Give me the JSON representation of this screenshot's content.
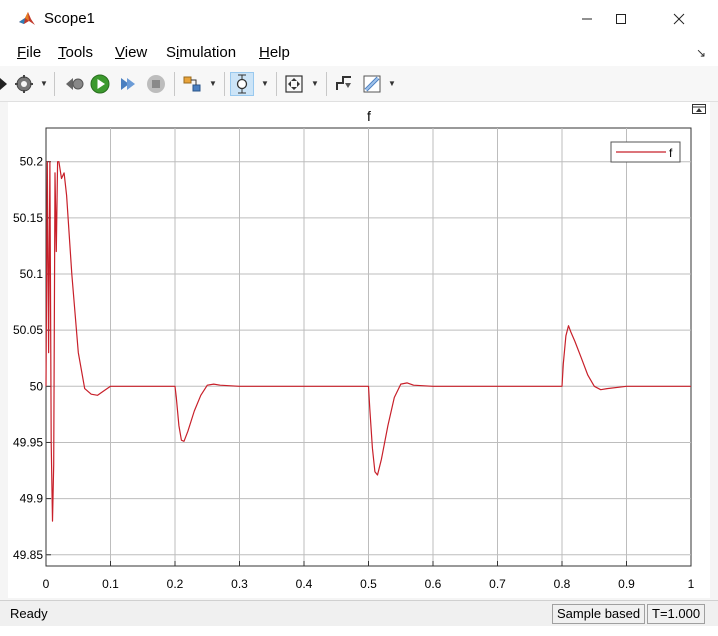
{
  "window": {
    "title": "Scope1",
    "icon": "matlab-logo-icon"
  },
  "menu": [
    {
      "label": "File",
      "mnemonic": "F",
      "rest": "ile"
    },
    {
      "label": "Tools",
      "mnemonic": "T",
      "rest": "ools"
    },
    {
      "label": "View",
      "mnemonic": "V",
      "rest": "iew"
    },
    {
      "label": "Simulation",
      "mnemonic": "i",
      "pre": "S",
      "rest": "mulation"
    },
    {
      "label": "Help",
      "mnemonic": "H",
      "rest": "elp"
    }
  ],
  "toolbar": {
    "icons": [
      "settings-gear-icon",
      "step-back-icon",
      "run-icon",
      "step-forward-icon",
      "stop-icon",
      "highlight-block-icon",
      "zoom-cursor-icon",
      "autoscale-icon",
      "signal-triggers-icon",
      "measurements-icon"
    ]
  },
  "status": {
    "ready": "Ready",
    "sample_mode": "Sample based",
    "time": "T=1.000"
  },
  "colors": {
    "signal": "#c8202a",
    "grid": "#bdbdbd",
    "plot_bg": "#ffffff"
  },
  "chart_data": {
    "type": "line",
    "title": "f",
    "xlabel": "",
    "ylabel": "",
    "xlim": [
      0,
      1
    ],
    "ylim": [
      49.84,
      50.23
    ],
    "xticks": [
      0,
      0.1,
      0.2,
      0.3,
      0.4,
      0.5,
      0.6,
      0.7,
      0.8,
      0.9,
      1
    ],
    "xtick_labels": [
      "0",
      "0.1",
      "0.2",
      "0.3",
      "0.4",
      "0.5",
      "0.6",
      "0.7",
      "0.8",
      "0.9",
      "1"
    ],
    "yticks": [
      49.85,
      49.9,
      49.95,
      50,
      50.05,
      50.1,
      50.15,
      50.2
    ],
    "ytick_labels": [
      "49.85",
      "49.9",
      "49.95",
      "50",
      "50.05",
      "50.1",
      "50.15",
      "50.2"
    ],
    "grid": true,
    "legend": {
      "placement": "top-right",
      "entries": [
        "f"
      ]
    },
    "series": [
      {
        "name": "f",
        "x": [
          0,
          0.002,
          0.004,
          0.006,
          0.008,
          0.01,
          0.012,
          0.014,
          0.016,
          0.018,
          0.02,
          0.024,
          0.028,
          0.032,
          0.04,
          0.05,
          0.06,
          0.07,
          0.08,
          0.09,
          0.1,
          0.12,
          0.15,
          0.2,
          0.202,
          0.206,
          0.21,
          0.214,
          0.22,
          0.23,
          0.24,
          0.25,
          0.26,
          0.27,
          0.3,
          0.4,
          0.5,
          0.502,
          0.506,
          0.51,
          0.514,
          0.52,
          0.53,
          0.54,
          0.55,
          0.56,
          0.57,
          0.6,
          0.7,
          0.8,
          0.802,
          0.806,
          0.81,
          0.814,
          0.82,
          0.83,
          0.84,
          0.85,
          0.86,
          0.87,
          0.9,
          1
        ],
        "y": [
          50,
          50.2,
          50.03,
          50.2,
          49.95,
          49.88,
          49.93,
          50.19,
          50.12,
          50.2,
          50.2,
          50.185,
          50.19,
          50.17,
          50.1,
          50.03,
          49.998,
          49.993,
          49.992,
          49.996,
          50,
          50,
          50,
          50,
          49.99,
          49.965,
          49.952,
          49.951,
          49.96,
          49.978,
          49.992,
          50.001,
          50.002,
          50.001,
          50,
          50,
          50,
          49.98,
          49.945,
          49.924,
          49.921,
          49.935,
          49.965,
          49.99,
          50.002,
          50.003,
          50.001,
          50,
          50,
          50,
          50.02,
          50.045,
          50.054,
          50.048,
          50.04,
          50.025,
          50.01,
          50,
          49.997,
          49.998,
          50,
          50
        ]
      }
    ]
  }
}
